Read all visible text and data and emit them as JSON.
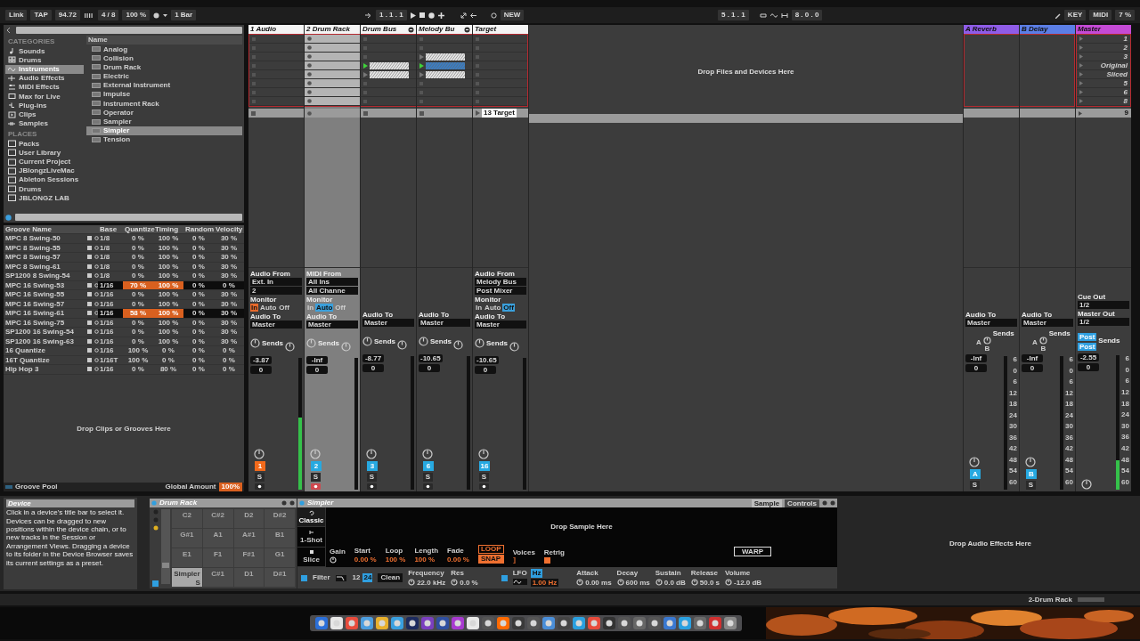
{
  "transport": {
    "link": "Link",
    "tap": "TAP",
    "tempo": "94.72",
    "signature": "4 / 8",
    "swing": "100 %",
    "quantize": "1 Bar",
    "position": "1 . 1 . 1",
    "new": "NEW",
    "loop_start": "5 . 1 . 1",
    "loop_length": "8 . 0 . 0",
    "key": "KEY",
    "midi": "MIDI",
    "cpu": "7 %"
  },
  "browser": {
    "categories_title": "CATEGORIES",
    "categories": [
      {
        "label": "Sounds",
        "selected": false
      },
      {
        "label": "Drums",
        "selected": false
      },
      {
        "label": "Instruments",
        "selected": true
      },
      {
        "label": "Audio Effects",
        "selected": false
      },
      {
        "label": "MIDI Effects",
        "selected": false
      },
      {
        "label": "Max for Live",
        "selected": false
      },
      {
        "label": "Plug-ins",
        "selected": false
      },
      {
        "label": "Clips",
        "selected": false
      },
      {
        "label": "Samples",
        "selected": false
      }
    ],
    "places_title": "PLACES",
    "places": [
      "Packs",
      "User Library",
      "Current Project",
      "JBlongzLiveMac",
      "Ableton Sessions",
      "Drums",
      "JBLONGZ LAB"
    ],
    "name_header": "Name",
    "items": [
      {
        "label": "Analog",
        "selected": false
      },
      {
        "label": "Collision",
        "selected": false
      },
      {
        "label": "Drum Rack",
        "selected": false
      },
      {
        "label": "Electric",
        "selected": false
      },
      {
        "label": "External Instrument",
        "selected": false
      },
      {
        "label": "Impulse",
        "selected": false
      },
      {
        "label": "Instrument Rack",
        "selected": false
      },
      {
        "label": "Operator",
        "selected": false
      },
      {
        "label": "Sampler",
        "selected": false
      },
      {
        "label": "Simpler",
        "selected": true
      },
      {
        "label": "Tension",
        "selected": false
      }
    ]
  },
  "groove_pool": {
    "columns": [
      "Groove Name",
      "Base",
      "Quantize",
      "Timing",
      "Random",
      "Velocity"
    ],
    "rows": [
      {
        "name": "MPC 8 Swing-50",
        "base": "1/8",
        "quantize": "0 %",
        "timing": "100 %",
        "random": "0 %",
        "velocity": "30 %",
        "active": false
      },
      {
        "name": "MPC 8 Swing-55",
        "base": "1/8",
        "quantize": "0 %",
        "timing": "100 %",
        "random": "0 %",
        "velocity": "30 %",
        "active": false
      },
      {
        "name": "MPC 8 Swing-57",
        "base": "1/8",
        "quantize": "0 %",
        "timing": "100 %",
        "random": "0 %",
        "velocity": "30 %",
        "active": false
      },
      {
        "name": "MPC 8 Swing-61",
        "base": "1/8",
        "quantize": "0 %",
        "timing": "100 %",
        "random": "0 %",
        "velocity": "30 %",
        "active": false
      },
      {
        "name": "SP1200 8 Swing-54",
        "base": "1/8",
        "quantize": "0 %",
        "timing": "100 %",
        "random": "0 %",
        "velocity": "30 %",
        "active": false
      },
      {
        "name": "MPC 16 Swing-53",
        "base": "1/16",
        "quantize": "70 %",
        "timing": "100 %",
        "random": "0 %",
        "velocity": "0 %",
        "active": true
      },
      {
        "name": "MPC 16 Swing-55",
        "base": "1/16",
        "quantize": "0 %",
        "timing": "100 %",
        "random": "0 %",
        "velocity": "30 %",
        "active": false
      },
      {
        "name": "MPC 16 Swing-57",
        "base": "1/16",
        "quantize": "0 %",
        "timing": "100 %",
        "random": "0 %",
        "velocity": "30 %",
        "active": false
      },
      {
        "name": "MPC 16 Swing-61",
        "base": "1/16",
        "quantize": "58 %",
        "timing": "100 %",
        "random": "0 %",
        "velocity": "30 %",
        "active": true
      },
      {
        "name": "MPC 16 Swing-75",
        "base": "1/16",
        "quantize": "0 %",
        "timing": "100 %",
        "random": "0 %",
        "velocity": "30 %",
        "active": false
      },
      {
        "name": "SP1200 16 Swing-54",
        "base": "1/16",
        "quantize": "0 %",
        "timing": "100 %",
        "random": "0 %",
        "velocity": "30 %",
        "active": false
      },
      {
        "name": "SP1200 16 Swing-63",
        "base": "1/16",
        "quantize": "0 %",
        "timing": "100 %",
        "random": "0 %",
        "velocity": "30 %",
        "active": false
      },
      {
        "name": "16 Quantize",
        "base": "1/16",
        "quantize": "100 %",
        "timing": "0 %",
        "random": "0 %",
        "velocity": "0 %",
        "active": false
      },
      {
        "name": "16T Quantize",
        "base": "1/16T",
        "quantize": "100 %",
        "timing": "0 %",
        "random": "0 %",
        "velocity": "0 %",
        "active": false
      },
      {
        "name": "Hip Hop 3",
        "base": "1/16",
        "quantize": "0 %",
        "timing": "80 %",
        "random": "0 %",
        "velocity": "0 %",
        "active": false
      }
    ],
    "drop_hint": "Drop Clips or Grooves Here",
    "title": "Groove Pool",
    "amount_label": "Global Amount",
    "amount": "100%"
  },
  "session": {
    "drop_hint": "Drop Files and Devices Here",
    "tracks": [
      {
        "name": "1 Audio",
        "color": "#f4f4f4",
        "group": false,
        "selected": false,
        "kind": "audio",
        "slots": [
          {
            "kind": "empty"
          },
          {
            "kind": "empty"
          },
          {
            "kind": "empty"
          },
          {
            "kind": "empty"
          },
          {
            "kind": "empty"
          },
          {
            "kind": "empty"
          },
          {
            "kind": "empty"
          },
          {
            "kind": "empty"
          }
        ],
        "mixer": {
          "input_label": "Audio From",
          "input": "Ext. In",
          "input_sub": "2",
          "monitor_label": "Monitor",
          "monitor": [
            {
              "label": "In",
              "selected": true
            },
            {
              "label": "Auto",
              "selected": false
            },
            {
              "label": "Off",
              "selected": false
            }
          ],
          "output_label": "Audio To",
          "output": "Master",
          "sends_label": "Sends",
          "volume": "-3.87",
          "pan": "0",
          "activator": {
            "label": "1",
            "color": "#f26a1b"
          },
          "solo": "S",
          "armed": false,
          "meter": {
            "level": 0.55
          }
        }
      },
      {
        "name": "2 Drum Rack",
        "color": "#f4f4f4",
        "group": false,
        "selected": true,
        "kind": "midi",
        "slots": [
          {
            "kind": "empty"
          },
          {
            "kind": "empty"
          },
          {
            "kind": "empty"
          },
          {
            "kind": "empty"
          },
          {
            "kind": "empty"
          },
          {
            "kind": "empty"
          },
          {
            "kind": "empty"
          },
          {
            "kind": "empty"
          }
        ],
        "mixer": {
          "input_label": "MIDI From",
          "input": "All Ins",
          "input_sub": "All Channe",
          "monitor_label": "Monitor",
          "monitor": [
            {
              "label": "In",
              "selected": false
            },
            {
              "label": "Auto",
              "selected": true
            },
            {
              "label": "Off",
              "selected": false
            }
          ],
          "output_label": "Audio To",
          "output": "Master",
          "sends_label": "Sends",
          "volume": "-Inf",
          "pan": "0",
          "activator": {
            "label": "2",
            "color": "#27a9e1"
          },
          "solo": "S",
          "armed": true,
          "meter": {
            "level": 0
          }
        }
      },
      {
        "name": "Drum Bus",
        "color": "#f4f4f4",
        "group": true,
        "selected": false,
        "kind": "audio",
        "slots": [
          {
            "kind": "empty"
          },
          {
            "kind": "empty"
          },
          {
            "kind": "empty"
          },
          {
            "kind": "clip",
            "playing": true,
            "color": "#e8e8e8"
          },
          {
            "kind": "clip",
            "playing": false,
            "color": "#e8e8e8"
          },
          {
            "kind": "empty"
          },
          {
            "kind": "empty"
          },
          {
            "kind": "empty"
          }
        ],
        "mixer": {
          "output_label": "Audio To",
          "output": "Master",
          "sends_label": "Sends",
          "volume": "-8.77",
          "pan": "0",
          "activator": {
            "label": "3",
            "color": "#27a9e1"
          },
          "solo": "S",
          "armed": false,
          "meter": {
            "level": 0
          }
        }
      },
      {
        "name": "Melody Bu",
        "color": "#f4f4f4",
        "group": true,
        "selected": false,
        "kind": "audio",
        "slots": [
          {
            "kind": "empty"
          },
          {
            "kind": "empty"
          },
          {
            "kind": "clip",
            "playing": false,
            "color": "#e8e8e8"
          },
          {
            "kind": "clip",
            "playing": true,
            "color": "#3a7ec4"
          },
          {
            "kind": "clip",
            "playing": false,
            "color": "#e8e8e8"
          },
          {
            "kind": "empty"
          },
          {
            "kind": "empty"
          },
          {
            "kind": "empty"
          }
        ],
        "mixer": {
          "output_label": "Audio To",
          "output": "Master",
          "sends_label": "Sends",
          "volume": "-10.65",
          "pan": "0",
          "activator": {
            "label": "6",
            "color": "#27a9e1"
          },
          "solo": "S",
          "armed": false,
          "meter": {
            "level": 0
          }
        }
      },
      {
        "name": "Target",
        "color": "#f4f4f4",
        "group": false,
        "selected": false,
        "kind": "audio",
        "stop_label": "13 Target",
        "slots": [
          {
            "kind": "empty"
          },
          {
            "kind": "empty"
          },
          {
            "kind": "empty"
          },
          {
            "kind": "empty"
          },
          {
            "kind": "empty"
          },
          {
            "kind": "empty"
          },
          {
            "kind": "empty"
          },
          {
            "kind": "empty"
          }
        ],
        "mixer": {
          "input_label": "Audio From",
          "input": "Melody Bus",
          "input_sub": "Post Mixer",
          "monitor_label": "Monitor",
          "monitor": [
            {
              "label": "In",
              "selected": false
            },
            {
              "label": "Auto",
              "selected": false
            },
            {
              "label": "Off",
              "selected": true
            }
          ],
          "output_label": "Audio To",
          "output": "Master",
          "sends_label": "Sends",
          "volume": "-10.65",
          "pan": "0",
          "activator": {
            "label": "16",
            "color": "#27a9e1"
          },
          "solo": "S",
          "armed": false,
          "meter": {
            "level": 0
          }
        }
      }
    ],
    "returns": [
      {
        "name": "A Reverb",
        "color": "#8f5ce8",
        "mixer": {
          "output_label": "Audio To",
          "output": "Master",
          "sends_label": "Sends",
          "send_labels": [
            "A",
            "B"
          ],
          "volume": "-Inf",
          "pan": "0",
          "activator": {
            "label": "A",
            "color": "#27a9e1"
          },
          "solo": "S",
          "meter": {
            "level": 0
          },
          "scale": [
            "6",
            "0",
            "6",
            "12",
            "18",
            "24",
            "30",
            "36",
            "42",
            "48",
            "54",
            "60"
          ]
        }
      },
      {
        "name": "B Delay",
        "color": "#5b7ee6",
        "mixer": {
          "output_label": "Audio To",
          "output": "Master",
          "sends_label": "Sends",
          "send_labels": [
            "A",
            "B"
          ],
          "volume": "-Inf",
          "pan": "0",
          "activator": {
            "label": "B",
            "color": "#27a9e1"
          },
          "solo": "S",
          "meter": {
            "level": 0
          },
          "scale": [
            "6",
            "0",
            "6",
            "12",
            "18",
            "24",
            "30",
            "36",
            "42",
            "48",
            "54",
            "60"
          ]
        }
      }
    ],
    "master": {
      "name": "Master",
      "color": "#c54ad6",
      "scenes": [
        "1",
        "2",
        "3",
        "Original",
        "Sliced",
        "5",
        "6",
        "8"
      ],
      "stop_scene": "9",
      "mixer": {
        "cue_label": "Cue Out",
        "cue": "1/2",
        "master_label": "Master Out",
        "master_out": "1/2",
        "sends_label": "Sends",
        "post": [
          "Post",
          "Post"
        ],
        "volume": "-2.55",
        "pan": "0",
        "meter": {
          "level": 0.22
        },
        "scale": [
          "6",
          "0",
          "6",
          "12",
          "18",
          "24",
          "30",
          "36",
          "42",
          "48",
          "54",
          "60"
        ]
      }
    }
  },
  "device_view": {
    "info": {
      "title": "Device",
      "text": "Click in a device's title bar to select it. Devices can be dragged to new positions within the device chain, or to new tracks in the Session or Arrangement Views. Dragging a device to its folder in the Device Browser saves its current settings as a preset."
    },
    "drum_rack": {
      "title": "Drum Rack",
      "pads": [
        {
          "label": "C2",
          "selected": false
        },
        {
          "label": "C#2",
          "selected": false
        },
        {
          "label": "D2",
          "selected": false
        },
        {
          "label": "D#2",
          "selected": false
        },
        {
          "label": "G#1",
          "selected": false
        },
        {
          "label": "A1",
          "selected": false
        },
        {
          "label": "A#1",
          "selected": false
        },
        {
          "label": "B1",
          "selected": false
        },
        {
          "label": "E1",
          "selected": false
        },
        {
          "label": "F1",
          "selected": false
        },
        {
          "label": "F#1",
          "selected": false
        },
        {
          "label": "G1",
          "selected": false
        },
        {
          "label": "Simpler",
          "selected": true
        },
        {
          "label": "C#1",
          "selected": false
        },
        {
          "label": "D1",
          "selected": false
        },
        {
          "label": "D#1",
          "selected": false
        }
      ],
      "pad_solo": "S"
    },
    "simpler": {
      "title": "Simpler",
      "tabs": [
        {
          "label": "Sample",
          "selected": true
        },
        {
          "label": "Controls",
          "selected": false
        }
      ],
      "modes": [
        {
          "label": "Classic",
          "selected": true
        },
        {
          "label": "1-Shot",
          "selected": false
        },
        {
          "label": "Slice",
          "selected": false
        }
      ],
      "drop_hint": "Drop Sample Here",
      "params": [
        {
          "label": "Gain"
        },
        {
          "label": "Start",
          "value": "0.00 %"
        },
        {
          "label": "Loop",
          "value": "100 %"
        },
        {
          "label": "Length",
          "value": "100 %"
        },
        {
          "label": "Fade",
          "value": "0.00 %"
        }
      ],
      "loop": "LOOP",
      "snap": "SNAP",
      "voices_label": "Voices",
      "retrig_label": "Retrig",
      "warp": "WARP",
      "filter_label": "Filter",
      "slopes": [
        {
          "label": "12",
          "selected": false
        },
        {
          "label": "24",
          "selected": true
        }
      ],
      "filter_type": "Clean",
      "freq_label": "Frequency",
      "freq": "22.0 kHz",
      "res_label": "Res",
      "res": "0.0 %",
      "lfo_label": "LFO",
      "lfo_unit": "Hz",
      "lfo_rate": "1.00 Hz",
      "envelope": [
        {
          "label": "Attack",
          "value": "0.00 ms"
        },
        {
          "label": "Decay",
          "value": "600 ms"
        },
        {
          "label": "Sustain",
          "value": "0.0 dB"
        },
        {
          "label": "Release",
          "value": "50.0 s"
        },
        {
          "label": "Volume",
          "value": "-12.0 dB"
        }
      ]
    },
    "effects_hint": "Drop Audio Effects Here"
  },
  "status_bar": {
    "track": "2-Drum Rack"
  }
}
